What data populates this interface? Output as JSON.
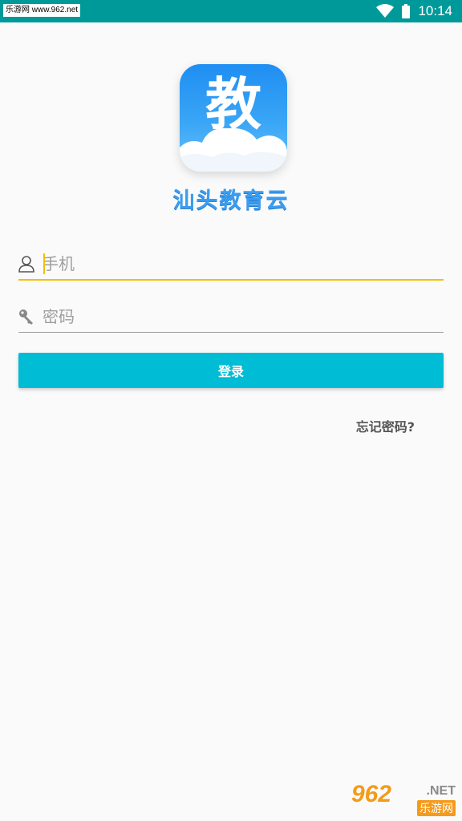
{
  "status_bar": {
    "watermark": "乐游网 www.962.net",
    "time": "10:14",
    "wifi_icon": "wifi-icon",
    "battery_icon": "battery-icon"
  },
  "logo": {
    "char": "教",
    "app_name": "汕头教育云"
  },
  "form": {
    "phone_placeholder": "手机",
    "phone_value": "",
    "password_placeholder": "密码",
    "password_value": "",
    "login_label": "登录",
    "forgot_label": "忘记密码?"
  },
  "watermark_bottom": {
    "num": "962",
    "net": ".NET",
    "cn": "乐游网"
  },
  "colors": {
    "status_bar": "#00999a",
    "accent": "#f5c000",
    "button": "#00bcd4"
  }
}
